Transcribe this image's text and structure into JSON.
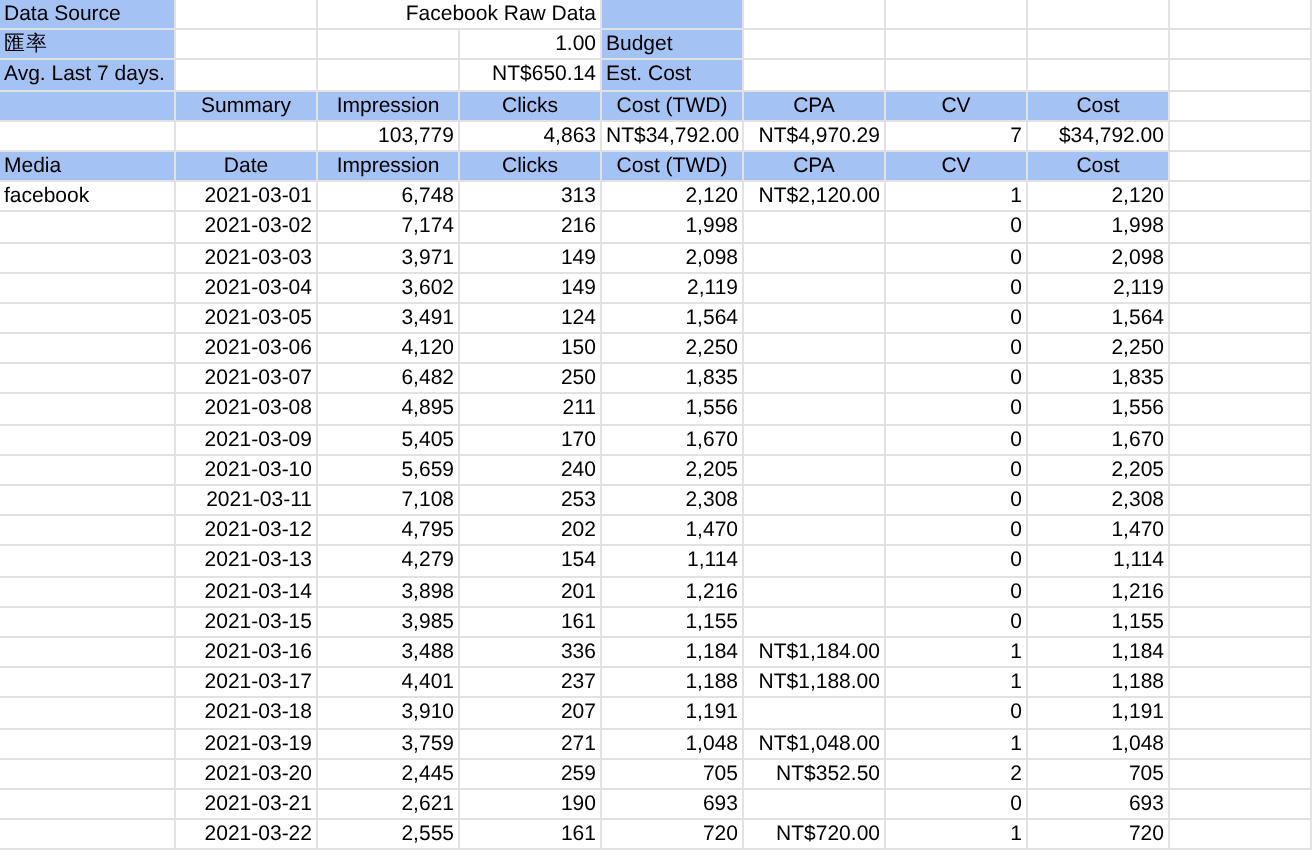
{
  "info_rows": [
    {
      "label": "Data Source",
      "value": "Facebook Raw Data"
    },
    {
      "label": "匯率",
      "value": "1.00",
      "note": "Budget"
    },
    {
      "label": "Avg. Last 7 days.",
      "value": "NT$650.14",
      "note": "Est. Cost"
    }
  ],
  "summary": {
    "columns": [
      "Summary",
      "Impression",
      "Clicks",
      "Cost (TWD)",
      "CPA",
      "CV",
      "Cost"
    ],
    "values": [
      "103,779",
      "4,863",
      "NT$34,792.00",
      "NT$4,970.29",
      "7",
      "$34,792.00"
    ]
  },
  "table": {
    "columns": [
      "Media",
      "Date",
      "Impression",
      "Clicks",
      "Cost (TWD)",
      "CPA",
      "CV",
      "Cost"
    ],
    "rows": [
      {
        "media": "facebook",
        "date": "2021-03-01",
        "impression": "6,748",
        "clicks": "313",
        "cost_twd": "2,120",
        "cpa": "NT$2,120.00",
        "cv": "1",
        "cost": "2,120"
      },
      {
        "date": "2021-03-02",
        "impression": "7,174",
        "clicks": "216",
        "cost_twd": "1,998",
        "cv": "0",
        "cost": "1,998"
      },
      {
        "date": "2021-03-03",
        "impression": "3,971",
        "clicks": "149",
        "cost_twd": "2,098",
        "cv": "0",
        "cost": "2,098"
      },
      {
        "date": "2021-03-04",
        "impression": "3,602",
        "clicks": "149",
        "cost_twd": "2,119",
        "cv": "0",
        "cost": "2,119"
      },
      {
        "date": "2021-03-05",
        "impression": "3,491",
        "clicks": "124",
        "cost_twd": "1,564",
        "cv": "0",
        "cost": "1,564"
      },
      {
        "date": "2021-03-06",
        "impression": "4,120",
        "clicks": "150",
        "cost_twd": "2,250",
        "cv": "0",
        "cost": "2,250"
      },
      {
        "date": "2021-03-07",
        "impression": "6,482",
        "clicks": "250",
        "cost_twd": "1,835",
        "cv": "0",
        "cost": "1,835"
      },
      {
        "date": "2021-03-08",
        "impression": "4,895",
        "clicks": "211",
        "cost_twd": "1,556",
        "cv": "0",
        "cost": "1,556"
      },
      {
        "date": "2021-03-09",
        "impression": "5,405",
        "clicks": "170",
        "cost_twd": "1,670",
        "cv": "0",
        "cost": "1,670"
      },
      {
        "date": "2021-03-10",
        "impression": "5,659",
        "clicks": "240",
        "cost_twd": "2,205",
        "cv": "0",
        "cost": "2,205"
      },
      {
        "date": "2021-03-11",
        "impression": "7,108",
        "clicks": "253",
        "cost_twd": "2,308",
        "cv": "0",
        "cost": "2,308"
      },
      {
        "date": "2021-03-12",
        "impression": "4,795",
        "clicks": "202",
        "cost_twd": "1,470",
        "cv": "0",
        "cost": "1,470"
      },
      {
        "date": "2021-03-13",
        "impression": "4,279",
        "clicks": "154",
        "cost_twd": "1,114",
        "cv": "0",
        "cost": "1,114"
      },
      {
        "date": "2021-03-14",
        "impression": "3,898",
        "clicks": "201",
        "cost_twd": "1,216",
        "cv": "0",
        "cost": "1,216"
      },
      {
        "date": "2021-03-15",
        "impression": "3,985",
        "clicks": "161",
        "cost_twd": "1,155",
        "cv": "0",
        "cost": "1,155"
      },
      {
        "date": "2021-03-16",
        "impression": "3,488",
        "clicks": "336",
        "cost_twd": "1,184",
        "cpa": "NT$1,184.00",
        "cv": "1",
        "cost": "1,184"
      },
      {
        "date": "2021-03-17",
        "impression": "4,401",
        "clicks": "237",
        "cost_twd": "1,188",
        "cpa": "NT$1,188.00",
        "cv": "1",
        "cost": "1,188"
      },
      {
        "date": "2021-03-18",
        "impression": "3,910",
        "clicks": "207",
        "cost_twd": "1,191",
        "cv": "0",
        "cost": "1,191"
      },
      {
        "date": "2021-03-19",
        "impression": "3,759",
        "clicks": "271",
        "cost_twd": "1,048",
        "cpa": "NT$1,048.00",
        "cv": "1",
        "cost": "1,048"
      },
      {
        "date": "2021-03-20",
        "impression": "2,445",
        "clicks": "259",
        "cost_twd": "705",
        "cpa": "NT$352.50",
        "cv": "2",
        "cost": "705"
      },
      {
        "date": "2021-03-21",
        "impression": "2,621",
        "clicks": "190",
        "cost_twd": "693",
        "cv": "0",
        "cost": "693"
      },
      {
        "date": "2021-03-22",
        "impression": "2,555",
        "clicks": "161",
        "cost_twd": "720",
        "cpa": "NT$720.00",
        "cv": "1",
        "cost": "720"
      }
    ]
  }
}
